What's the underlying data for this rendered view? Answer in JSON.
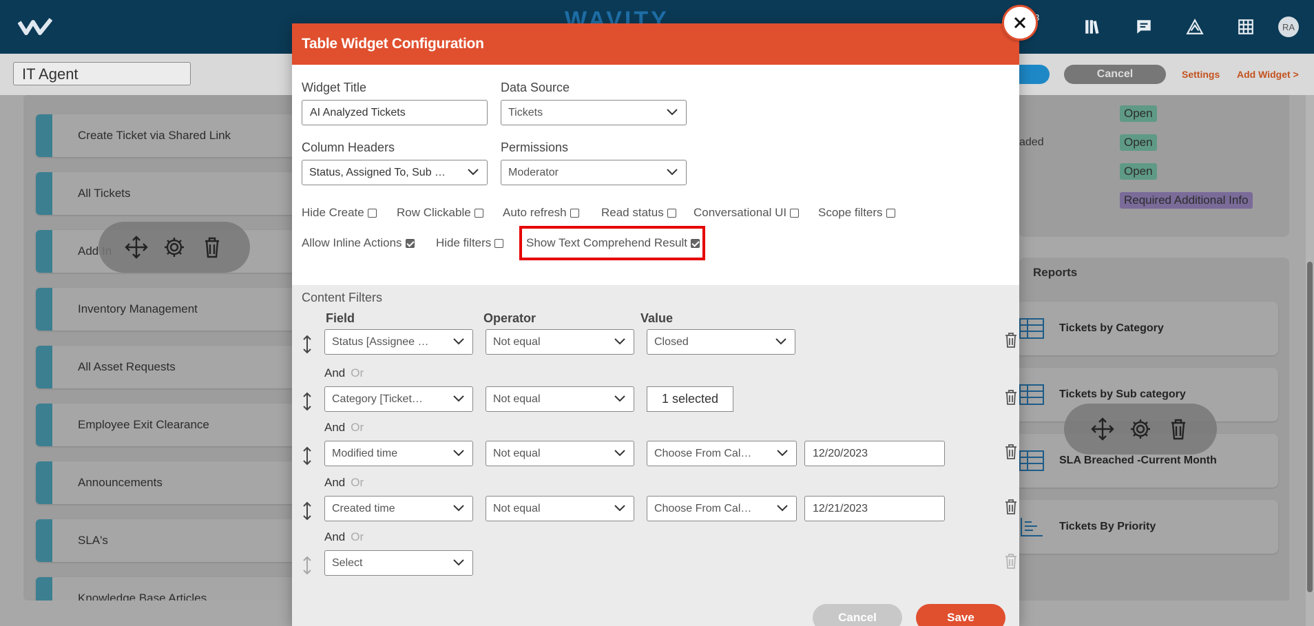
{
  "topbar": {
    "brand": "WAVITY",
    "notification_count": "3",
    "avatar_initials": "RA",
    "icons": [
      "search-icon",
      "notifications-icon",
      "library-icon",
      "chat-icon",
      "triangle-app-icon",
      "grid-apps-icon"
    ]
  },
  "subbar": {
    "page_name": "IT Agent",
    "cancel_label": "Cancel",
    "settings_label": "Settings",
    "add_widget_label": "Add Widget >"
  },
  "left_panel": {
    "items": [
      "Create Ticket via Shared Link",
      "All Tickets",
      "Add In",
      "Inventory Management",
      "All Asset Requests",
      "Employee Exit Clearance",
      "Announcements",
      "SLA's",
      "Knowledge Base Articles"
    ]
  },
  "right_table": {
    "rows": [
      {
        "text": "",
        "status": "Open"
      },
      {
        "text": "aded",
        "status": "Open"
      },
      {
        "text": "",
        "status": "Open"
      },
      {
        "text": "",
        "status": "Required Additional Info"
      }
    ]
  },
  "reports": {
    "title": "Reports",
    "items": [
      "Tickets by Category",
      "Tickets by Sub category",
      "SLA Breached -Current Month",
      "Tickets By Priority"
    ]
  },
  "modal": {
    "title": "Table Widget Configuration",
    "widget_title_label": "Widget Title",
    "widget_title_value": "AI Analyzed Tickets",
    "data_source_label": "Data Source",
    "data_source_value": "Tickets",
    "column_headers_label": "Column Headers",
    "column_headers_value": "Status, Assigned To, Sub …",
    "permissions_label": "Permissions",
    "permissions_value": "Moderator",
    "checkboxes_row1": [
      {
        "label": "Hide Create",
        "checked": false
      },
      {
        "label": "Row Clickable",
        "checked": false
      },
      {
        "label": "Auto refresh",
        "checked": false
      },
      {
        "label": "Read status",
        "checked": false
      },
      {
        "label": "Conversational UI",
        "checked": false
      },
      {
        "label": "Scope filters",
        "checked": false
      }
    ],
    "checkboxes_row2": [
      {
        "label": "Allow Inline Actions",
        "checked": true
      },
      {
        "label": "Hide filters",
        "checked": false
      },
      {
        "label": "Show Text Comprehend Result",
        "checked": true
      }
    ],
    "content_filters": {
      "title": "Content Filters",
      "col_field": "Field",
      "col_operator": "Operator",
      "col_value": "Value",
      "and_label": "And",
      "or_label": "Or",
      "rows": [
        {
          "field": "Status [Assignee …",
          "operator": "Not equal",
          "value": "Closed"
        },
        {
          "field": "Category [Ticket…",
          "operator": "Not equal",
          "value": "1 selected"
        },
        {
          "field": "Modified time",
          "operator": "Not equal",
          "value": "Choose From Cal…",
          "date": "12/20/2023"
        },
        {
          "field": "Created time",
          "operator": "Not equal",
          "value": "Choose From Cal…",
          "date": "12/21/2023"
        },
        {
          "field": "Select"
        }
      ]
    },
    "cancel_label": "Cancel",
    "save_label": "Save"
  },
  "colors": {
    "topbar": "#0b3a56",
    "accent": "#e04f2e",
    "highlight": "#e60000"
  }
}
